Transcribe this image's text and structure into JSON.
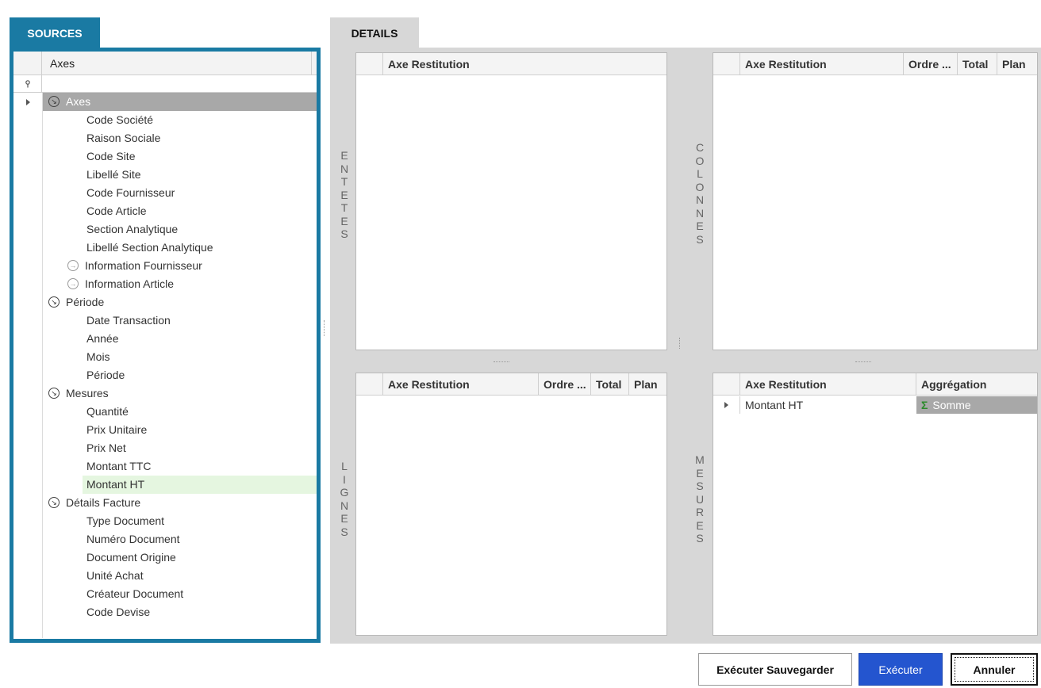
{
  "tabs": {
    "sources": "SOURCES",
    "details": "DETAILS"
  },
  "sources": {
    "column_header": "Axes",
    "filter_icon": "pin-icon",
    "tree": [
      {
        "label": "Axes",
        "level": 0,
        "type": "group",
        "selected": true
      },
      {
        "label": "Code Société",
        "level": 2,
        "type": "leaf"
      },
      {
        "label": "Raison Sociale",
        "level": 2,
        "type": "leaf"
      },
      {
        "label": "Code Site",
        "level": 2,
        "type": "leaf"
      },
      {
        "label": "Libellé Site",
        "level": 2,
        "type": "leaf"
      },
      {
        "label": "Code Fournisseur",
        "level": 2,
        "type": "leaf"
      },
      {
        "label": "Code Article",
        "level": 2,
        "type": "leaf"
      },
      {
        "label": "Section Analytique",
        "level": 2,
        "type": "leaf"
      },
      {
        "label": "Libellé Section Analytique",
        "level": 2,
        "type": "leaf"
      },
      {
        "label": "Information Fournisseur",
        "level": 1,
        "type": "subgroup"
      },
      {
        "label": "Information Article",
        "level": 1,
        "type": "subgroup"
      },
      {
        "label": "Période",
        "level": 0,
        "type": "group"
      },
      {
        "label": "Date Transaction",
        "level": 2,
        "type": "leaf"
      },
      {
        "label": "Année",
        "level": 2,
        "type": "leaf"
      },
      {
        "label": "Mois",
        "level": 2,
        "type": "leaf"
      },
      {
        "label": "Période",
        "level": 2,
        "type": "leaf"
      },
      {
        "label": "Mesures",
        "level": 0,
        "type": "group"
      },
      {
        "label": "Quantité",
        "level": 2,
        "type": "leaf"
      },
      {
        "label": "Prix Unitaire",
        "level": 2,
        "type": "leaf"
      },
      {
        "label": "Prix Net",
        "level": 2,
        "type": "leaf"
      },
      {
        "label": "Montant TTC",
        "level": 2,
        "type": "leaf"
      },
      {
        "label": "Montant HT",
        "level": 2,
        "type": "leaf",
        "highlighted": true
      },
      {
        "label": "Détails Facture",
        "level": 0,
        "type": "group"
      },
      {
        "label": "Type Document",
        "level": 2,
        "type": "leaf"
      },
      {
        "label": "Numéro Document",
        "level": 2,
        "type": "leaf"
      },
      {
        "label": "Document Origine",
        "level": 2,
        "type": "leaf"
      },
      {
        "label": "Unité Achat",
        "level": 2,
        "type": "leaf"
      },
      {
        "label": "Créateur Document",
        "level": 2,
        "type": "leaf"
      },
      {
        "label": "Code Devise",
        "level": 2,
        "type": "leaf"
      }
    ]
  },
  "details": {
    "entetes": {
      "side_label": [
        "E",
        "N",
        "T",
        "E",
        "T",
        "E",
        "S"
      ],
      "columns": [
        "Axe Restitution"
      ]
    },
    "colonnes": {
      "side_label": [
        "C",
        "O",
        "L",
        "O",
        "N",
        "N",
        "E",
        "S"
      ],
      "columns": [
        "Axe Restitution",
        "Ordre ...",
        "Total",
        "Plan"
      ]
    },
    "lignes": {
      "side_label": [
        "L",
        "I",
        "G",
        "N",
        "E",
        "S"
      ],
      "columns": [
        "Axe Restitution",
        "Ordre ...",
        "Total",
        "Plan"
      ]
    },
    "mesures": {
      "side_label": [
        "M",
        "E",
        "S",
        "U",
        "R",
        "E",
        "S"
      ],
      "columns": [
        "Axe Restitution",
        "Aggrégation"
      ],
      "rows": [
        {
          "axe": "Montant HT",
          "aggregation": "Somme",
          "aggregation_icon": "sigma-icon"
        }
      ]
    }
  },
  "buttons": {
    "execute_save": "Exécuter  Sauvegarder",
    "execute": "Exécuter",
    "cancel": "Annuler"
  },
  "colors": {
    "accent": "#1a7aa3",
    "primary_button": "#2455cf",
    "selected_row": "#a8a8a8",
    "highlight_row": "#e5f6e0",
    "panel_bg": "#d7d7d7"
  }
}
